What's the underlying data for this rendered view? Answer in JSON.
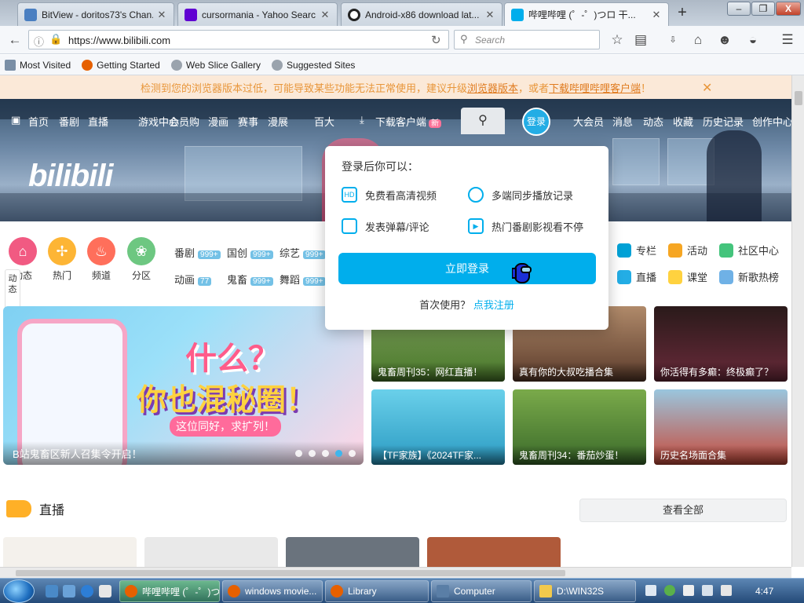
{
  "browser": {
    "tabs": [
      {
        "label": "BitView - doritos73's Chan...",
        "favicon_color": "#4a7fc1"
      },
      {
        "label": "cursormania - Yahoo Searc...",
        "favicon_color": "#6001d2"
      },
      {
        "label": "Android-x86 download lat...",
        "favicon_color": "#222222"
      },
      {
        "label": "哔哩哔哩 (゜-゜)つロ 干...",
        "favicon_color": "#00aeec"
      }
    ],
    "new_tab": "+",
    "window_controls": {
      "minimize": "–",
      "restore": "❐",
      "close": "X"
    },
    "url": "https://www.bilibili.com",
    "search_placeholder": "Search",
    "bookmarks": [
      "Most Visited",
      "Getting Started",
      "Web Slice Gallery",
      "Suggested Sites"
    ]
  },
  "notice": {
    "text": "检测到您的浏览器版本过低，可能导致某些功能无法正常使用，建议升级",
    "link1": "浏览器版本",
    "mid": "，或者",
    "link2": "下载哔哩哔哩客户端",
    "tail": "！"
  },
  "header": {
    "nav_left": [
      "首页",
      "番剧",
      "直播",
      "游戏中心",
      "会员购",
      "漫画",
      "赛事",
      "漫展",
      "百大"
    ],
    "download": "下载客户端",
    "new_badge": "新",
    "avatar": "登录",
    "nav_right": [
      "大会员",
      "消息",
      "动态",
      "收藏",
      "历史记录",
      "创作中心"
    ],
    "logo": "bilibili"
  },
  "popover": {
    "title": "登录后你可以：",
    "items": [
      "免费看高清视频",
      "多端同步播放记录",
      "发表弹幕/评论",
      "热门番剧影视看不停"
    ],
    "login_button": "立即登录",
    "register_prompt": "首次使用？",
    "register_link": "点我注册"
  },
  "channels": [
    {
      "label": "动态",
      "color": "#f15a82"
    },
    {
      "label": "热门",
      "color": "#fdb535"
    },
    {
      "label": "频道",
      "color": "#ff6f5b"
    },
    {
      "label": "分区",
      "color": "#6dc781"
    }
  ],
  "categories": {
    "row1": [
      {
        "label": "番剧",
        "count": "999+"
      },
      {
        "label": "国创",
        "count": "999+"
      },
      {
        "label": "综艺",
        "count": "999+"
      }
    ],
    "row2": [
      {
        "label": "动画",
        "count": "77"
      },
      {
        "label": "鬼畜",
        "count": "999+"
      },
      {
        "label": "舞蹈",
        "count": "999+"
      }
    ]
  },
  "side_links": {
    "row1": [
      {
        "label": "专栏",
        "color": "#00a1d6"
      },
      {
        "label": "活动",
        "color": "#f6a623"
      },
      {
        "label": "社区中心",
        "color": "#44c47c"
      }
    ],
    "row2": [
      {
        "label": "直播",
        "color": "#23ade5"
      },
      {
        "label": "课堂",
        "color": "#ffd23f"
      },
      {
        "label": "新歌热榜",
        "color": "#6fb1e6"
      }
    ]
  },
  "side_tab": "动态",
  "carousel": {
    "caption": "B站鬼畜区新人召集令开启！",
    "promo_line1": "什么？",
    "promo_line2": "你也混秘圈！",
    "promo_line3": "这位同好，求扩列！"
  },
  "grid": [
    {
      "caption": "鬼畜周刊35：网红直播！",
      "color": "#5c8a3a"
    },
    {
      "caption": "真有你的大叔吃播合集",
      "color": "#8a6a4a"
    },
    {
      "caption": "你活得有多癫：终极癫了？",
      "color": "#3a2a2a"
    },
    {
      "caption": "【TF家族】《2024TF家...",
      "color": "#36a8c9"
    },
    {
      "caption": "鬼畜周刊34：番茄炒蛋！",
      "color": "#4a7a2a"
    },
    {
      "caption": "历史名场面合集",
      "color": "#6fa7c2"
    }
  ],
  "live": {
    "heading": "直播",
    "more_button": "查看全部",
    "thumb_colors": [
      "#f4f1ec",
      "#e9e9e9",
      "#6a737d",
      "#b05a3a"
    ]
  },
  "taskbar": {
    "buttons": [
      "哔哩哔哩 (゜-゜)つロ ...",
      "windows movie...",
      "Library",
      "Computer",
      "D:\\WIN32S"
    ],
    "clock": "4:47"
  }
}
